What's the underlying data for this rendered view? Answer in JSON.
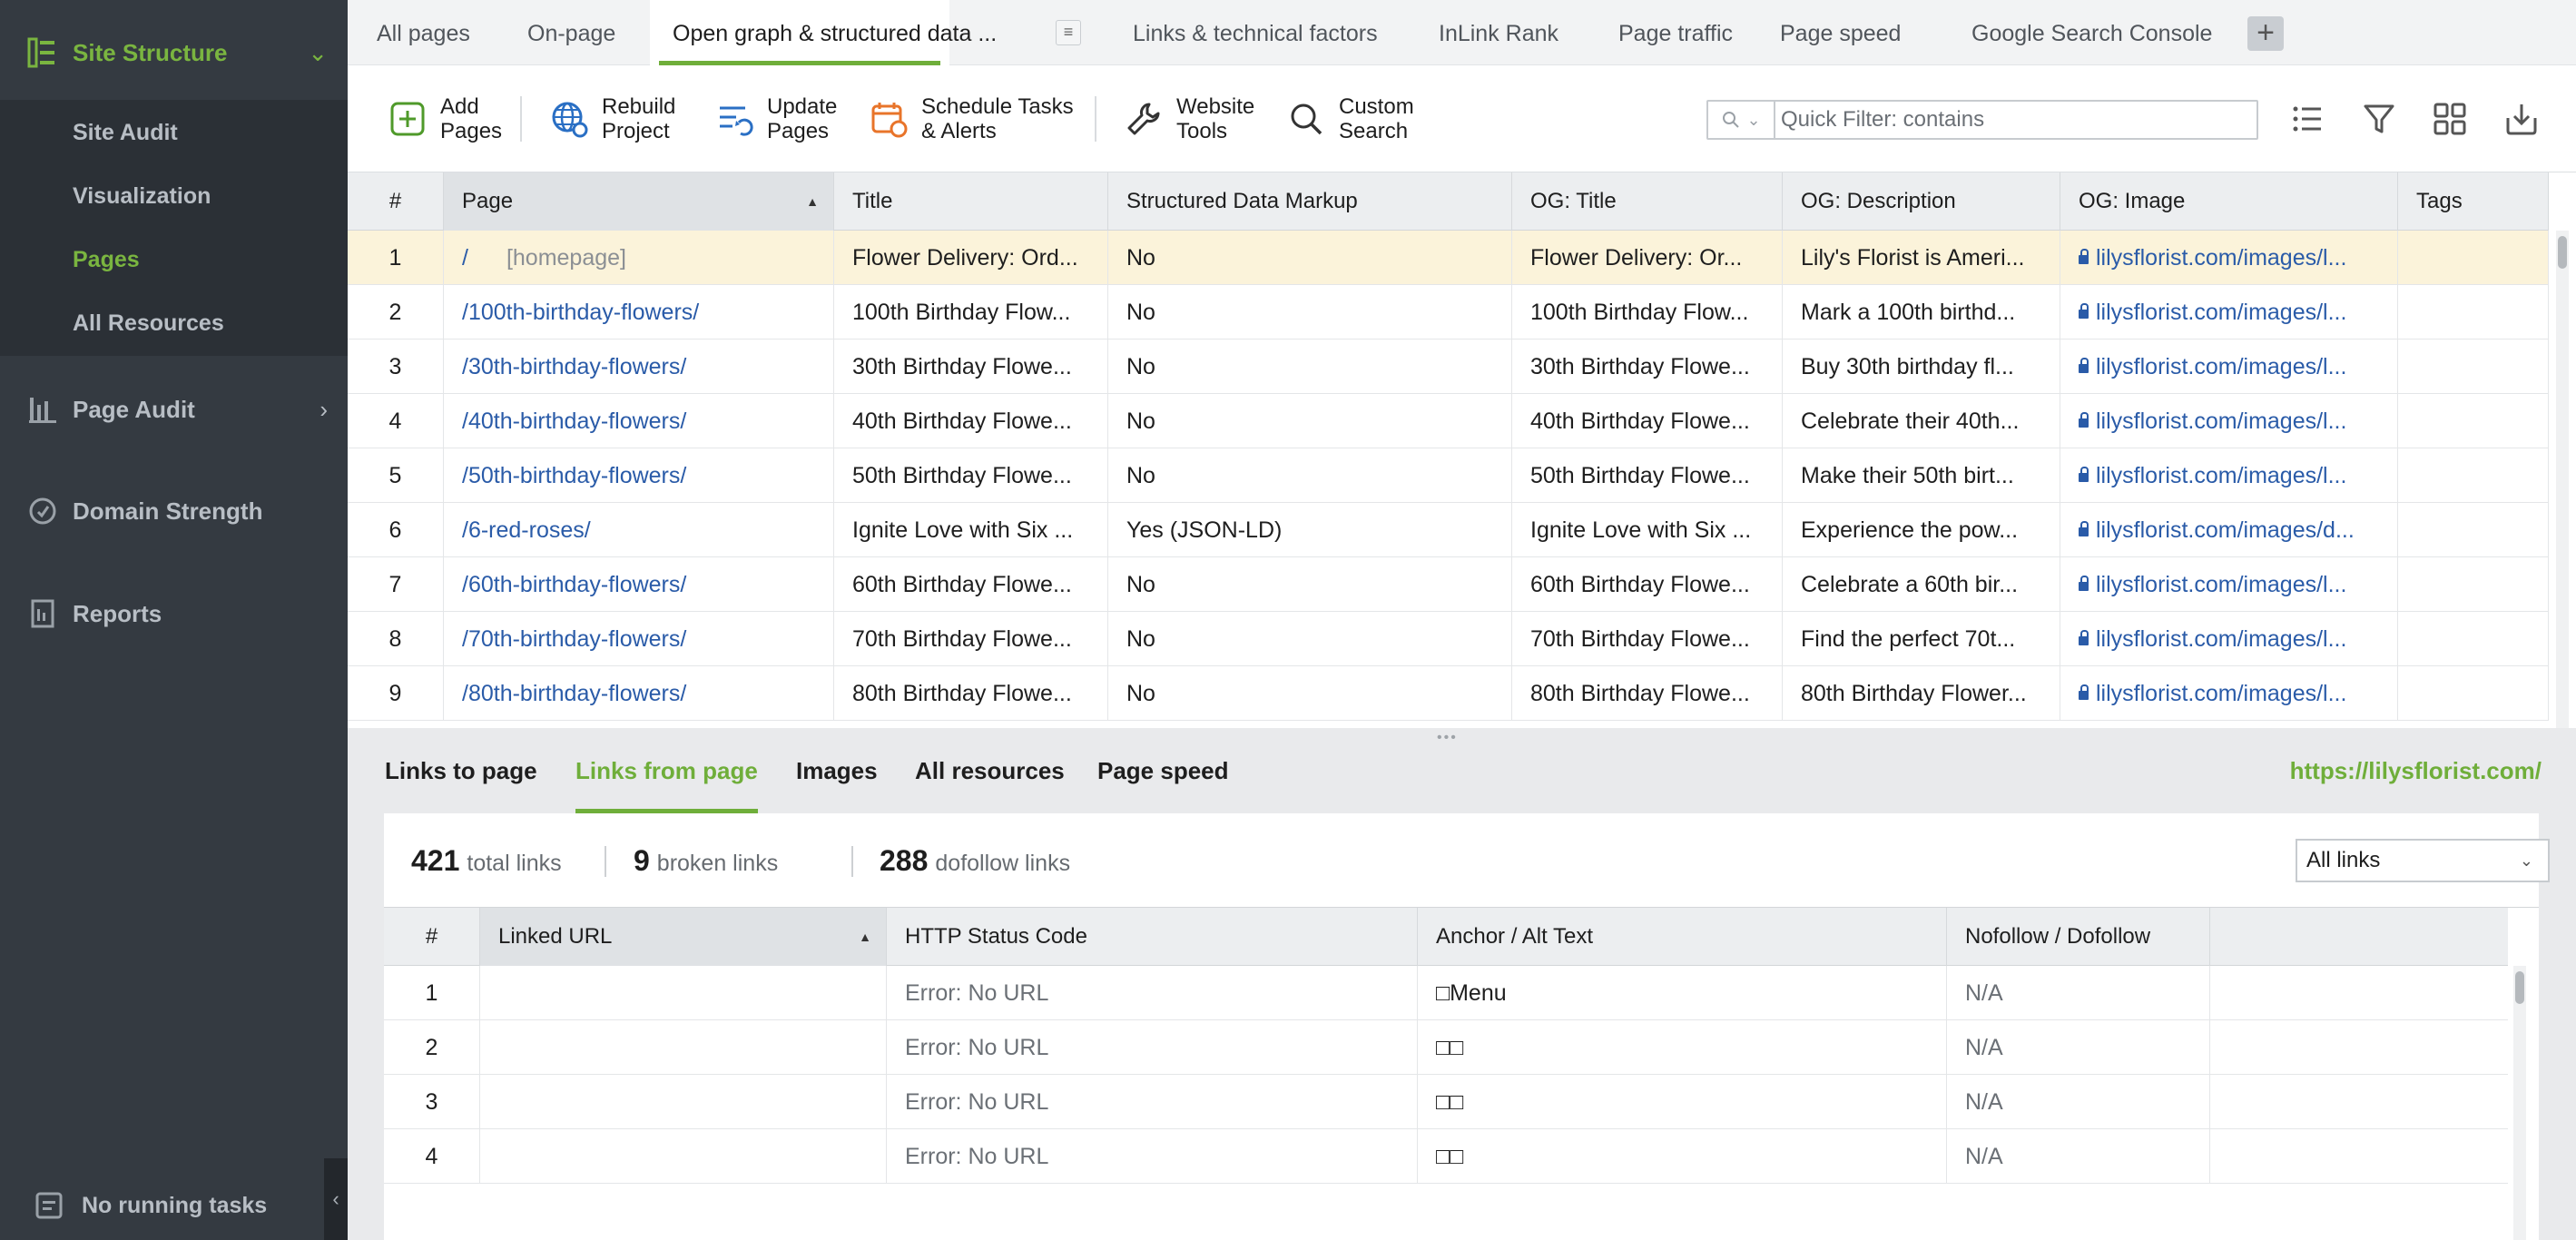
{
  "sidebar": {
    "site_structure": "Site Structure",
    "sub_items": [
      "Site Audit",
      "Visualization",
      "Pages",
      "All Resources"
    ],
    "active_sub": "Pages",
    "page_audit": "Page Audit",
    "domain_strength": "Domain Strength",
    "reports": "Reports",
    "no_running_tasks": "No running tasks",
    "collapse_glyph": "‹",
    "accent_color": "#7ab540"
  },
  "tabs": [
    {
      "label": "All pages"
    },
    {
      "label": "On-page"
    },
    {
      "label": "Open graph & structured data ..."
    },
    {
      "label": "Links & technical factors"
    },
    {
      "label": "InLink Rank"
    },
    {
      "label": "Page traffic"
    },
    {
      "label": "Page speed"
    },
    {
      "label": "Google Search Console"
    }
  ],
  "active_tab": "Open graph & structured data ...",
  "toolbar": {
    "add_pages": "Add\nPages",
    "rebuild_project": "Rebuild\nProject",
    "update_pages": "Update\nPages",
    "schedule_tasks": "Schedule Tasks\n& Alerts",
    "website_tools": "Website\nTools",
    "custom_search": "Custom\nSearch",
    "quick_filter_placeholder": "Quick Filter: contains",
    "icons": [
      "list-view-icon",
      "filter-icon",
      "grid-view-icon",
      "export-icon"
    ]
  },
  "main_table": {
    "columns": [
      "#",
      "Page",
      "Title",
      "Structured Data Markup",
      "OG: Title",
      "OG: Description",
      "OG: Image",
      "Tags"
    ],
    "rows": [
      {
        "n": "1",
        "page": "/",
        "homepage": "[homepage]",
        "title": "Flower Delivery: Ord...",
        "sdm": "No",
        "og_title": "Flower Delivery: Or...",
        "og_desc": "Lily's Florist is Ameri...",
        "og_image": "lilysflorist.com/images/l...",
        "tags": ""
      },
      {
        "n": "2",
        "page": "/100th-birthday-flowers/",
        "homepage": "",
        "title": "100th Birthday Flow...",
        "sdm": "No",
        "og_title": "100th Birthday Flow...",
        "og_desc": "Mark a 100th birthd...",
        "og_image": "lilysflorist.com/images/l...",
        "tags": ""
      },
      {
        "n": "3",
        "page": "/30th-birthday-flowers/",
        "homepage": "",
        "title": "30th Birthday Flowe...",
        "sdm": "No",
        "og_title": "30th Birthday Flowe...",
        "og_desc": "Buy 30th birthday fl...",
        "og_image": "lilysflorist.com/images/l...",
        "tags": ""
      },
      {
        "n": "4",
        "page": "/40th-birthday-flowers/",
        "homepage": "",
        "title": "40th Birthday Flowe...",
        "sdm": "No",
        "og_title": "40th Birthday Flowe...",
        "og_desc": "Celebrate their 40th...",
        "og_image": "lilysflorist.com/images/l...",
        "tags": ""
      },
      {
        "n": "5",
        "page": "/50th-birthday-flowers/",
        "homepage": "",
        "title": "50th Birthday Flowe...",
        "sdm": "No",
        "og_title": "50th Birthday Flowe...",
        "og_desc": "Make their 50th birt...",
        "og_image": "lilysflorist.com/images/l...",
        "tags": ""
      },
      {
        "n": "6",
        "page": "/6-red-roses/",
        "homepage": "",
        "title": "Ignite Love with Six ...",
        "sdm": "Yes (JSON-LD)",
        "og_title": "Ignite Love with Six ...",
        "og_desc": "Experience the pow...",
        "og_image": "lilysflorist.com/images/d...",
        "tags": ""
      },
      {
        "n": "7",
        "page": "/60th-birthday-flowers/",
        "homepage": "",
        "title": "60th Birthday Flowe...",
        "sdm": "No",
        "og_title": "60th Birthday Flowe...",
        "og_desc": "Celebrate a 60th bir...",
        "og_image": "lilysflorist.com/images/l...",
        "tags": ""
      },
      {
        "n": "8",
        "page": "/70th-birthday-flowers/",
        "homepage": "",
        "title": "70th Birthday Flowe...",
        "sdm": "No",
        "og_title": "70th Birthday Flowe...",
        "og_desc": "Find the perfect 70t...",
        "og_image": "lilysflorist.com/images/l...",
        "tags": ""
      },
      {
        "n": "9",
        "page": "/80th-birthday-flowers/",
        "homepage": "",
        "title": "80th Birthday Flowe...",
        "sdm": "No",
        "og_title": "80th Birthday Flowe...",
        "og_desc": "80th Birthday Flower...",
        "og_image": "lilysflorist.com/images/l...",
        "tags": ""
      }
    ]
  },
  "bottom_panel": {
    "tabs": [
      "Links to page",
      "Links from page",
      "Images",
      "All resources",
      "Page speed"
    ],
    "active_tab": "Links from page",
    "url": "https://lilysflorist.com/",
    "stats": [
      {
        "value": "421",
        "label": "total links"
      },
      {
        "value": "9",
        "label": "broken links"
      },
      {
        "value": "288",
        "label": "dofollow links"
      }
    ],
    "links_filter": "All links",
    "columns": [
      "#",
      "Linked URL",
      "HTTP Status Code",
      "Anchor / Alt Text",
      "Nofollow / Dofollow"
    ],
    "rows": [
      {
        "n": "1",
        "url": "",
        "status": "Error: No URL",
        "anchor": "□Menu",
        "follow": "N/A"
      },
      {
        "n": "2",
        "url": "",
        "status": "Error: No URL",
        "anchor": "□□",
        "follow": "N/A"
      },
      {
        "n": "3",
        "url": "",
        "status": "Error: No URL",
        "anchor": "□□",
        "follow": "N/A"
      },
      {
        "n": "4",
        "url": "",
        "status": "Error: No URL",
        "anchor": "□□",
        "follow": "N/A"
      }
    ]
  },
  "colors": {
    "accent_green": "#6fae3a",
    "link_blue": "#2a5ba8",
    "selected_row": "#fbf3da",
    "sidebar_bg": "#343a41"
  }
}
